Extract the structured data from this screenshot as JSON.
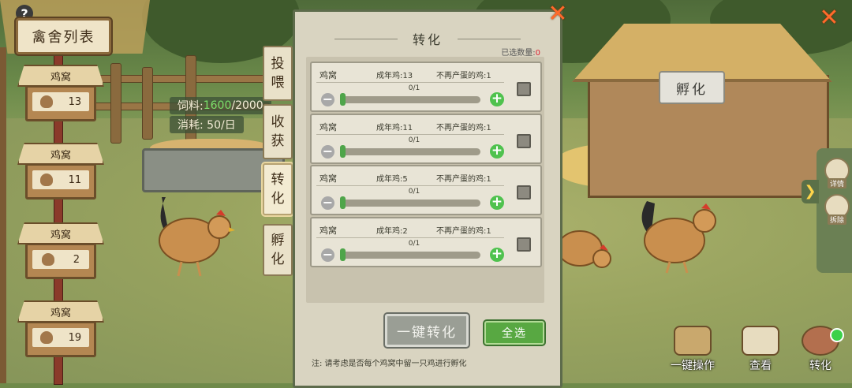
{
  "help": "?",
  "coop_list_title": "禽舍列表",
  "coops": [
    {
      "name": "鸡窝",
      "count": "13"
    },
    {
      "name": "鸡窝",
      "count": "11"
    },
    {
      "name": "鸡窝",
      "count": "2"
    },
    {
      "name": "鸡窝",
      "count": "19"
    }
  ],
  "stats": {
    "feed_label": "饲料: ",
    "feed_value": "1600",
    "feed_max": "/2000",
    "consume": "消耗: 50/日"
  },
  "side_tabs": [
    {
      "label": "投\n喂"
    },
    {
      "label": "收\n获"
    },
    {
      "label": "转\n化"
    },
    {
      "label": "孵\n化"
    }
  ],
  "panel": {
    "title": "转化",
    "selected_label": "已选数量:",
    "selected_value": "0",
    "rows": [
      {
        "name": "鸡窝",
        "adult": "成年鸡:13",
        "nolay": "不再产蛋的鸡:1",
        "count": "0/1",
        "progress": 0
      },
      {
        "name": "鸡窝",
        "adult": "成年鸡:11",
        "nolay": "不再产蛋的鸡:1",
        "count": "0/1",
        "progress": 0
      },
      {
        "name": "鸡窝",
        "adult": "成年鸡:5",
        "nolay": "不再产蛋的鸡:1",
        "count": "0/1",
        "progress": 0
      },
      {
        "name": "鸡窝",
        "adult": "成年鸡:2",
        "nolay": "不再产蛋的鸡:1",
        "count": "0/1",
        "progress": 0
      }
    ],
    "convert_button": "一键转化",
    "select_all_button": "全选",
    "note": "注: 请考虑是否每个鸡窝中留一只鸡进行孵化"
  },
  "hatch_sign": "孵化",
  "right_panel": [
    {
      "label": "详情"
    },
    {
      "label": "拆除"
    }
  ],
  "bottom_bar": [
    {
      "label": "一键操作",
      "icon": "coop-hand-icon"
    },
    {
      "label": "查看",
      "icon": "scroll-icon"
    },
    {
      "label": "转化",
      "icon": "drumstick-icon"
    }
  ],
  "colors": {
    "accent_green": "#58a842",
    "close_orange": "#ff6a2b",
    "selected_red": "#dd2233"
  }
}
